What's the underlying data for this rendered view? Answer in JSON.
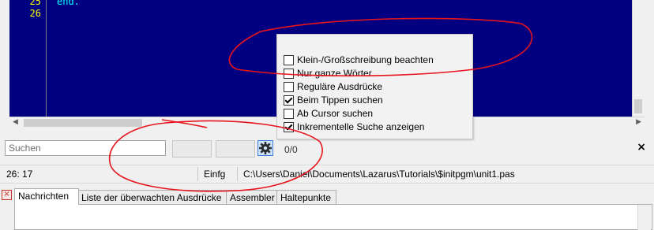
{
  "editor": {
    "lines": [
      {
        "number": "25",
        "text": "end."
      },
      {
        "number": "26",
        "text": ""
      }
    ]
  },
  "search": {
    "placeholder": "Suchen",
    "value": "",
    "match_count": "0/0",
    "options_icon": "gear-icon",
    "close_icon": "close-icon",
    "close_glyph": "×"
  },
  "search_options": [
    {
      "label": "Klein-/Großschreibung beachten",
      "checked": false
    },
    {
      "label": "Nur ganze Wörter",
      "checked": false
    },
    {
      "label": "Reguläre Ausdrücke",
      "checked": false
    },
    {
      "label": "Beim Tippen suchen",
      "checked": true
    },
    {
      "label": "Ab Cursor suchen",
      "checked": false
    },
    {
      "label": "Inkrementelle Suche anzeigen",
      "checked": true
    }
  ],
  "status": {
    "position": "26: 17",
    "mode": "Einfg",
    "file_path": "C:\\Users\\Daniel\\Documents\\Lazarus\\Tutorials\\$initpgm\\unit1.pas"
  },
  "messages": {
    "tabs": [
      {
        "label": "Nachrichten",
        "active": true
      },
      {
        "label": "Liste der überwachten Ausdrücke",
        "active": false
      },
      {
        "label": "Assembler",
        "active": false
      },
      {
        "label": "Haltepunkte",
        "active": false
      }
    ]
  },
  "colors": {
    "editor_background": "#000080",
    "line_number": "#ffff00",
    "code_text": "#00ffff",
    "annotation": "#e8141c"
  }
}
